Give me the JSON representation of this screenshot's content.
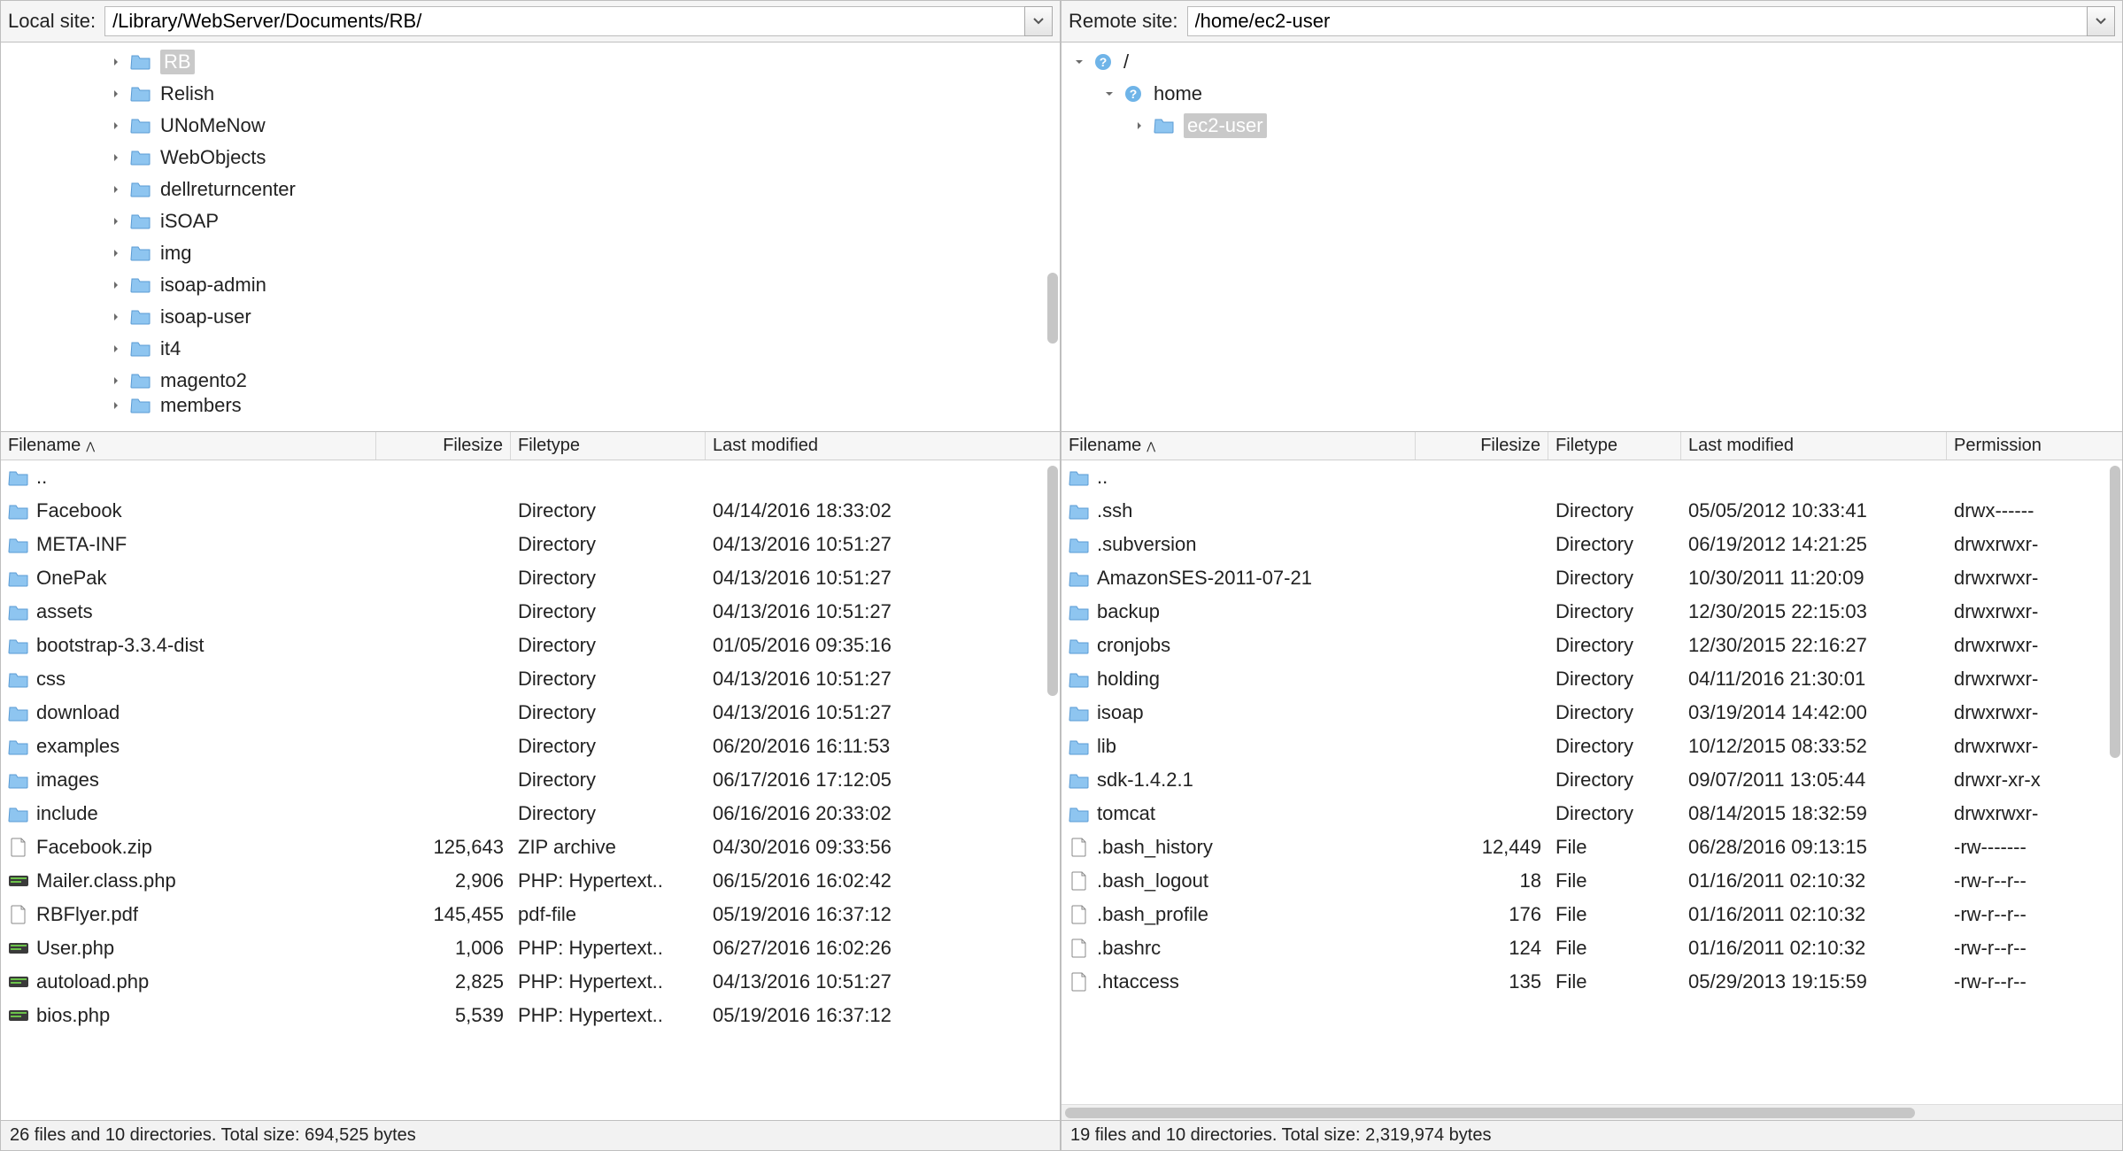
{
  "local": {
    "path_label": "Local site:",
    "path_value": "/Library/WebServer/Documents/RB/",
    "tree": [
      {
        "indent": 3,
        "expanded": false,
        "icon": "folder-open",
        "label": "RB",
        "selected": true
      },
      {
        "indent": 3,
        "expanded": false,
        "icon": "folder",
        "label": "Relish"
      },
      {
        "indent": 3,
        "expanded": false,
        "icon": "folder",
        "label": "UNoMeNow"
      },
      {
        "indent": 3,
        "expanded": false,
        "icon": "folder",
        "label": "WebObjects"
      },
      {
        "indent": 3,
        "expanded": false,
        "icon": "folder",
        "label": "dellreturncenter"
      },
      {
        "indent": 3,
        "expanded": false,
        "icon": "folder",
        "label": "iSOAP"
      },
      {
        "indent": 3,
        "expanded": false,
        "icon": "folder",
        "label": "img"
      },
      {
        "indent": 3,
        "expanded": false,
        "icon": "folder",
        "label": "isoap-admin"
      },
      {
        "indent": 3,
        "expanded": false,
        "icon": "folder",
        "label": "isoap-user"
      },
      {
        "indent": 3,
        "expanded": false,
        "icon": "folder",
        "label": "it4"
      },
      {
        "indent": 3,
        "expanded": false,
        "icon": "folder",
        "label": "magento2"
      },
      {
        "indent": 3,
        "expanded": false,
        "icon": "folder",
        "label": "members",
        "partial": true
      }
    ],
    "columns": {
      "name": "Filename",
      "size": "Filesize",
      "type": "Filetype",
      "modified": "Last modified"
    },
    "rows": [
      {
        "icon": "folder",
        "name": "..",
        "size": "",
        "type": "",
        "modified": ""
      },
      {
        "icon": "folder",
        "name": "Facebook",
        "size": "",
        "type": "Directory",
        "modified": "04/14/2016 18:33:02"
      },
      {
        "icon": "folder",
        "name": "META-INF",
        "size": "",
        "type": "Directory",
        "modified": "04/13/2016 10:51:27"
      },
      {
        "icon": "folder",
        "name": "OnePak",
        "size": "",
        "type": "Directory",
        "modified": "04/13/2016 10:51:27"
      },
      {
        "icon": "folder",
        "name": "assets",
        "size": "",
        "type": "Directory",
        "modified": "04/13/2016 10:51:27"
      },
      {
        "icon": "folder",
        "name": "bootstrap-3.3.4-dist",
        "size": "",
        "type": "Directory",
        "modified": "01/05/2016 09:35:16"
      },
      {
        "icon": "folder",
        "name": "css",
        "size": "",
        "type": "Directory",
        "modified": "04/13/2016 10:51:27"
      },
      {
        "icon": "folder",
        "name": "download",
        "size": "",
        "type": "Directory",
        "modified": "04/13/2016 10:51:27"
      },
      {
        "icon": "folder",
        "name": "examples",
        "size": "",
        "type": "Directory",
        "modified": "06/20/2016 16:11:53"
      },
      {
        "icon": "folder",
        "name": "images",
        "size": "",
        "type": "Directory",
        "modified": "06/17/2016 17:12:05"
      },
      {
        "icon": "folder",
        "name": "include",
        "size": "",
        "type": "Directory",
        "modified": "06/16/2016 20:33:02"
      },
      {
        "icon": "zip",
        "name": "Facebook.zip",
        "size": "125,643",
        "type": "ZIP archive",
        "modified": "04/30/2016 09:33:56"
      },
      {
        "icon": "php",
        "name": "Mailer.class.php",
        "size": "2,906",
        "type": "PHP: Hypertext..",
        "modified": "06/15/2016 16:02:42"
      },
      {
        "icon": "pdf",
        "name": "RBFlyer.pdf",
        "size": "145,455",
        "type": "pdf-file",
        "modified": "05/19/2016 16:37:12"
      },
      {
        "icon": "php",
        "name": "User.php",
        "size": "1,006",
        "type": "PHP: Hypertext..",
        "modified": "06/27/2016 16:02:26"
      },
      {
        "icon": "php",
        "name": "autoload.php",
        "size": "2,825",
        "type": "PHP: Hypertext..",
        "modified": "04/13/2016 10:51:27"
      },
      {
        "icon": "php",
        "name": "bios.php",
        "size": "5,539",
        "type": "PHP: Hypertext..",
        "modified": "05/19/2016 16:37:12"
      }
    ],
    "status": "26 files and 10 directories. Total size: 694,525 bytes"
  },
  "remote": {
    "path_label": "Remote site:",
    "path_value": "/home/ec2-user",
    "tree": [
      {
        "indent": 0,
        "expanded": true,
        "arrow": "down",
        "icon": "unknown",
        "label": "/"
      },
      {
        "indent": 1,
        "expanded": true,
        "arrow": "down",
        "icon": "unknown",
        "label": "home"
      },
      {
        "indent": 2,
        "expanded": false,
        "arrow": "right",
        "icon": "folder-open",
        "label": "ec2-user",
        "selected": true
      }
    ],
    "columns": {
      "name": "Filename",
      "size": "Filesize",
      "type": "Filetype",
      "modified": "Last modified",
      "permissions": "Permission"
    },
    "rows": [
      {
        "icon": "folder",
        "name": "..",
        "size": "",
        "type": "",
        "modified": "",
        "perm": ""
      },
      {
        "icon": "folder",
        "name": ".ssh",
        "size": "",
        "type": "Directory",
        "modified": "05/05/2012 10:33:41",
        "perm": "drwx------"
      },
      {
        "icon": "folder",
        "name": ".subversion",
        "size": "",
        "type": "Directory",
        "modified": "06/19/2012 14:21:25",
        "perm": "drwxrwxr-"
      },
      {
        "icon": "folder",
        "name": "AmazonSES-2011-07-21",
        "size": "",
        "type": "Directory",
        "modified": "10/30/2011 11:20:09",
        "perm": "drwxrwxr-"
      },
      {
        "icon": "folder",
        "name": "backup",
        "size": "",
        "type": "Directory",
        "modified": "12/30/2015 22:15:03",
        "perm": "drwxrwxr-"
      },
      {
        "icon": "folder",
        "name": "cronjobs",
        "size": "",
        "type": "Directory",
        "modified": "12/30/2015 22:16:27",
        "perm": "drwxrwxr-"
      },
      {
        "icon": "folder",
        "name": "holding",
        "size": "",
        "type": "Directory",
        "modified": "04/11/2016 21:30:01",
        "perm": "drwxrwxr-"
      },
      {
        "icon": "folder",
        "name": "isoap",
        "size": "",
        "type": "Directory",
        "modified": "03/19/2014 14:42:00",
        "perm": "drwxrwxr-"
      },
      {
        "icon": "folder",
        "name": "lib",
        "size": "",
        "type": "Directory",
        "modified": "10/12/2015 08:33:52",
        "perm": "drwxrwxr-"
      },
      {
        "icon": "folder",
        "name": "sdk-1.4.2.1",
        "size": "",
        "type": "Directory",
        "modified": "09/07/2011 13:05:44",
        "perm": "drwxr-xr-x"
      },
      {
        "icon": "folder",
        "name": "tomcat",
        "size": "",
        "type": "Directory",
        "modified": "08/14/2015 18:32:59",
        "perm": "drwxrwxr-"
      },
      {
        "icon": "file",
        "name": ".bash_history",
        "size": "12,449",
        "type": "File",
        "modified": "06/28/2016 09:13:15",
        "perm": "-rw-------"
      },
      {
        "icon": "file",
        "name": ".bash_logout",
        "size": "18",
        "type": "File",
        "modified": "01/16/2011 02:10:32",
        "perm": "-rw-r--r--"
      },
      {
        "icon": "file",
        "name": ".bash_profile",
        "size": "176",
        "type": "File",
        "modified": "01/16/2011 02:10:32",
        "perm": "-rw-r--r--"
      },
      {
        "icon": "file",
        "name": ".bashrc",
        "size": "124",
        "type": "File",
        "modified": "01/16/2011 02:10:32",
        "perm": "-rw-r--r--"
      },
      {
        "icon": "file",
        "name": ".htaccess",
        "size": "135",
        "type": "File",
        "modified": "05/29/2013 19:15:59",
        "perm": "-rw-r--r--"
      }
    ],
    "status": "19 files and 10 directories. Total size: 2,319,974 bytes"
  }
}
